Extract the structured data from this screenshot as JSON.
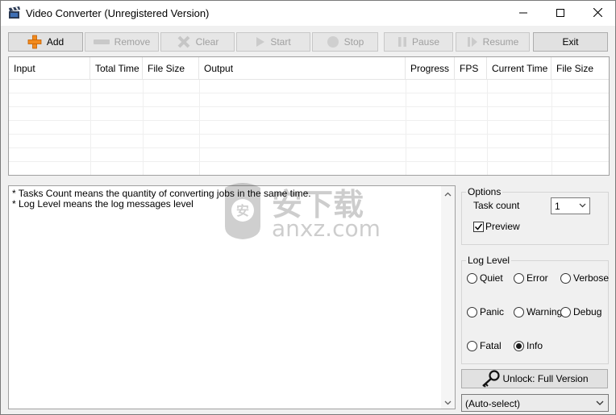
{
  "window": {
    "title": "Video Converter  (Unregistered Version)"
  },
  "toolbar": {
    "add_label": "Add",
    "remove_label": "Remove",
    "clear_label": "Clear",
    "start_label": "Start",
    "stop_label": "Stop",
    "pause_label": "Pause",
    "resume_label": "Resume",
    "exit_label": "Exit"
  },
  "table": {
    "columns": [
      "Input",
      "Total Time",
      "File Size",
      "Output",
      "Progress",
      "FPS",
      "Current Time",
      "File Size"
    ],
    "rows": []
  },
  "log": {
    "lines": [
      "  * Tasks Count means the quantity of converting jobs in the same time.",
      "* Log Level means the log messages level"
    ]
  },
  "options": {
    "group_label": "Options",
    "task_count_label": "Task count",
    "task_count_value": "1",
    "preview_label": "Preview",
    "preview_checked": true
  },
  "log_level": {
    "group_label": "Log Level",
    "levels": [
      "Quiet",
      "Error",
      "Verbose",
      "Panic",
      "Warning",
      "Debug",
      "Fatal",
      "Info"
    ],
    "selected": "Info"
  },
  "unlock_label": "Unlock: Full Version",
  "device_select_value": "(Auto-select)",
  "watermark": {
    "cn_text": "安下载",
    "domain_text": "anxz.com"
  }
}
